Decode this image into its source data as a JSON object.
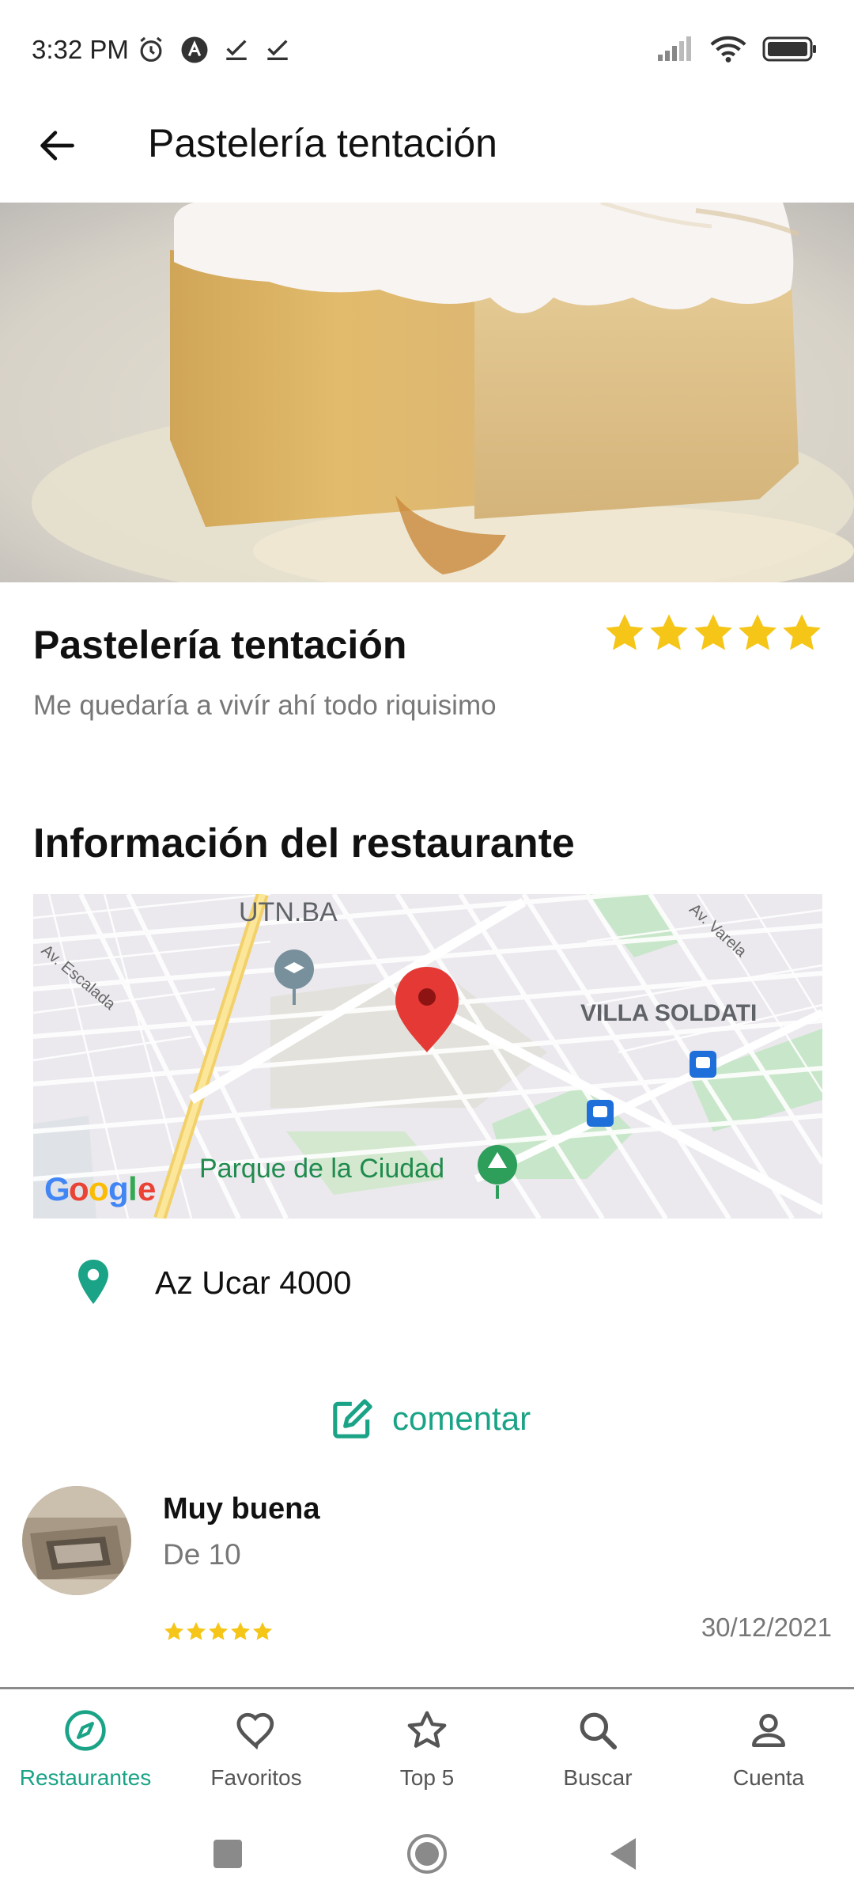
{
  "status_bar": {
    "time": "3:32 PM"
  },
  "app_bar": {
    "title": "Pastelería tentación"
  },
  "restaurant": {
    "name": "Pastelería tentación",
    "description": "Me quedaría a vivír ahí todo riquisimo",
    "rating": 5,
    "rating_max": 5
  },
  "info_section": {
    "title": "Información del restaurante"
  },
  "map": {
    "labels": {
      "utn": "UTN.BA",
      "escalada": "Av. Escalada",
      "varela": "Av. Varela",
      "soldati": "VILLA SOLDATI",
      "parque": "Parque de la Ciudad",
      "google": "Google"
    }
  },
  "address": {
    "text": "Az Ucar 4000"
  },
  "comment": {
    "label": "comentar"
  },
  "review": {
    "title": "Muy buena",
    "subtitle": "De 10",
    "rating": 5,
    "date": "30/12/2021"
  },
  "bottom_nav": {
    "items": [
      {
        "label": "Restaurantes",
        "icon": "compass-icon",
        "active": true
      },
      {
        "label": "Favoritos",
        "icon": "heart-icon",
        "active": false
      },
      {
        "label": "Top 5",
        "icon": "star-icon",
        "active": false
      },
      {
        "label": "Buscar",
        "icon": "search-icon",
        "active": false
      },
      {
        "label": "Cuenta",
        "icon": "account-icon",
        "active": false
      }
    ]
  },
  "colors": {
    "accent": "#1aa386",
    "star": "#f5c518",
    "pin": "#e53935"
  }
}
